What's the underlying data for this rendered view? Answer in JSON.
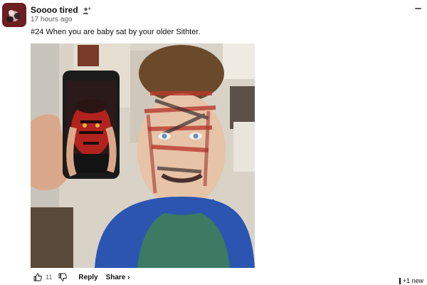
{
  "post": {
    "channel_name": "Soooo tired",
    "timestamp": "17 hours ago",
    "text": "#24 When you are baby sat by your older Sithter.",
    "image_subject": "child with face scribbled in marker next to a phone showing Darth Maul"
  },
  "actions": {
    "like_count": "11",
    "reply_label": "Reply",
    "share_label": "Share ›"
  },
  "indicator": {
    "new_label": "+1 new"
  },
  "icons": {
    "member": "member-icon",
    "menu": "menu-icon",
    "like": "thumbs-up-icon",
    "dislike": "thumbs-down-icon"
  },
  "colors": {
    "text_primary": "#0f0f0f",
    "text_secondary": "#606060",
    "avatar_red": "#6d1e22"
  }
}
